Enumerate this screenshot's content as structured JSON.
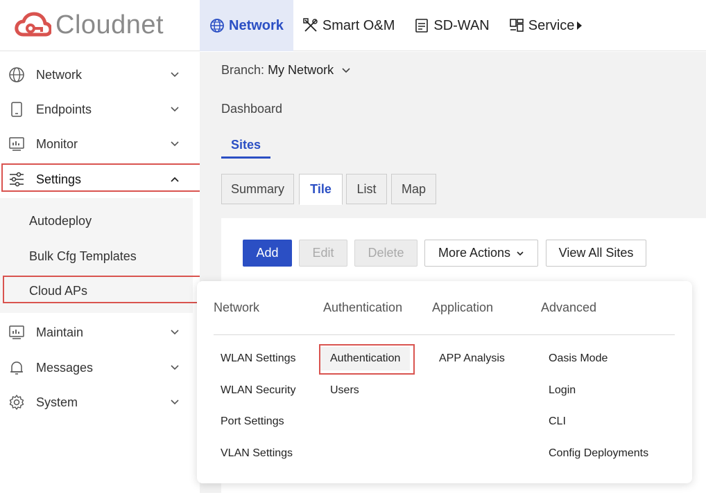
{
  "app": {
    "logo_text": "Cloudnet",
    "brand_color": "#d9534f",
    "accent_color": "#2b4fc4"
  },
  "topnav": [
    {
      "label": "Network",
      "icon": "globe-icon",
      "active": true
    },
    {
      "label": "Smart O&M",
      "icon": "tools-icon"
    },
    {
      "label": "SD-WAN",
      "icon": "document-icon"
    },
    {
      "label": "Service",
      "icon": "dashboard-icon"
    }
  ],
  "sidebar": {
    "items": [
      {
        "label": "Network",
        "icon": "globe-icon"
      },
      {
        "label": "Endpoints",
        "icon": "phone-icon"
      },
      {
        "label": "Monitor",
        "icon": "monitor-chart-icon"
      },
      {
        "label": "Settings",
        "icon": "sliders-icon",
        "expanded": true
      },
      {
        "label": "Maintain",
        "icon": "monitor-chart-icon"
      },
      {
        "label": "Messages",
        "icon": "bell-icon"
      },
      {
        "label": "System",
        "icon": "gear-icon"
      }
    ],
    "settings_sub": [
      "Autodeploy",
      "Bulk Cfg Templates",
      "Cloud APs"
    ]
  },
  "main": {
    "branch_label": "Branch:",
    "branch_value": "My Network",
    "breadcrumb": "Dashboard",
    "tab": "Sites",
    "subtabs": [
      "Summary",
      "Tile",
      "List",
      "Map"
    ],
    "active_subtab": "Tile",
    "buttons": {
      "add": "Add",
      "edit": "Edit",
      "delete": "Delete",
      "more": "More Actions",
      "view_all": "View All Sites"
    }
  },
  "dropdown": {
    "columns": [
      {
        "header": "Network",
        "items": [
          "WLAN Settings",
          "WLAN Security",
          "Port Settings",
          "VLAN Settings"
        ]
      },
      {
        "header": "Authentication",
        "items": [
          "Authentication",
          "Users"
        ]
      },
      {
        "header": "Application",
        "items": [
          "APP Analysis"
        ]
      },
      {
        "header": "Advanced",
        "items": [
          "Oasis Mode",
          "Login",
          "CLI",
          "Config Deployments"
        ]
      }
    ],
    "highlighted": "Authentication"
  }
}
